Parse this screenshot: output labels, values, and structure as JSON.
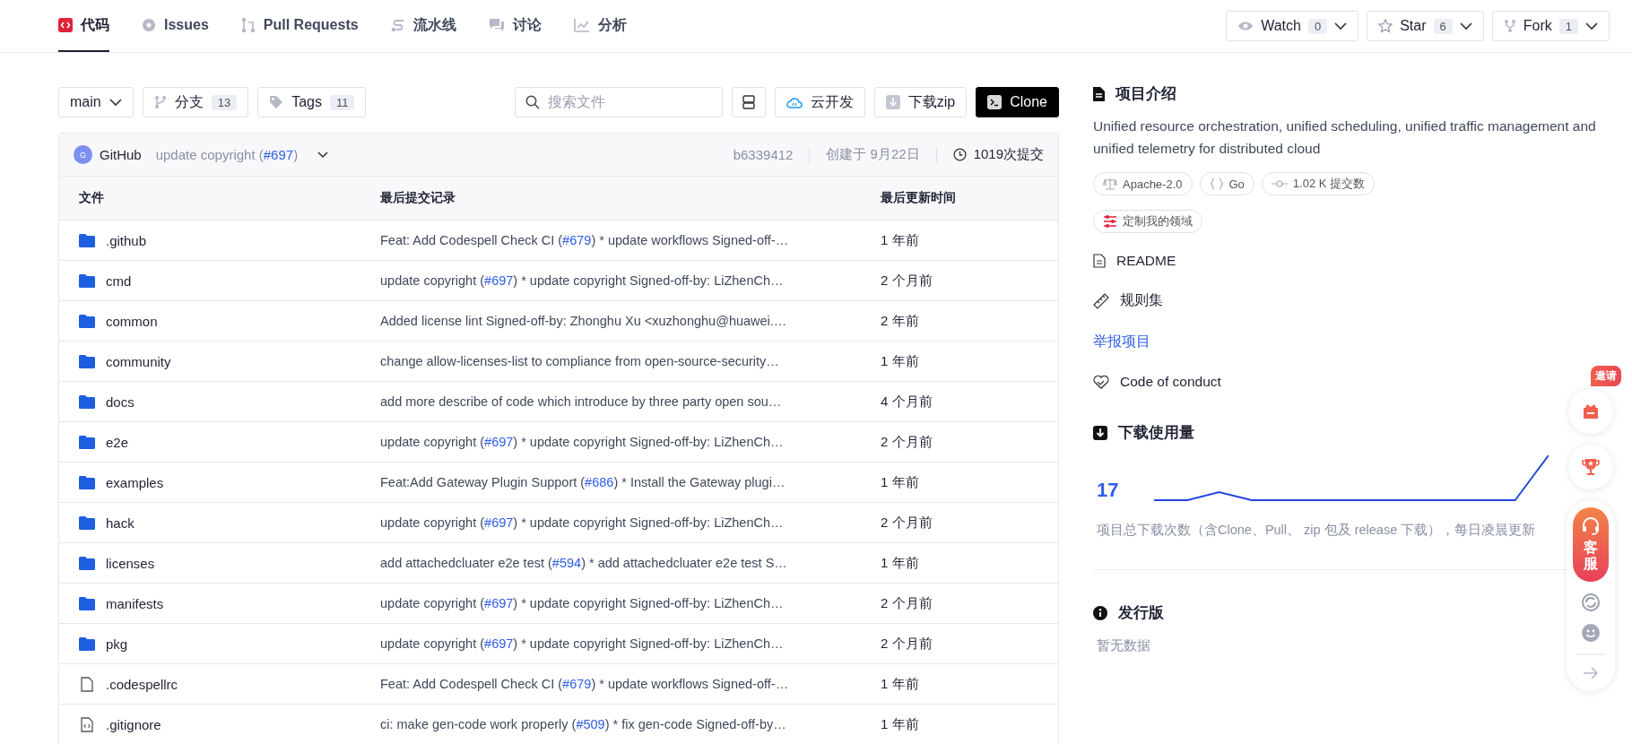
{
  "nav_tabs": [
    {
      "label": "代码",
      "kind": "code",
      "selected": true
    },
    {
      "label": "Issues",
      "kind": "issues",
      "selected": false
    },
    {
      "label": "Pull Requests",
      "kind": "pr",
      "selected": false
    },
    {
      "label": "流水线",
      "kind": "pipeline",
      "selected": false
    },
    {
      "label": "讨论",
      "kind": "discuss",
      "selected": false
    },
    {
      "label": "分析",
      "kind": "analytics",
      "selected": false
    }
  ],
  "repo_actions": [
    {
      "label": "Watch",
      "kind": "watch",
      "count": "0"
    },
    {
      "label": "Star",
      "kind": "star",
      "count": "6"
    },
    {
      "label": "Fork",
      "kind": "fork",
      "count": "1"
    }
  ],
  "toolbar": {
    "branch": "main",
    "branches": {
      "label": "分支",
      "count": "13"
    },
    "tags": {
      "label": "Tags",
      "count": "11"
    },
    "search": {
      "placeholder": "搜索文件"
    },
    "buttons": [
      {
        "label": "云开发",
        "kind": "cloud"
      },
      {
        "label": "下载zip",
        "kind": "download"
      },
      {
        "label": "Clone",
        "kind": "clone"
      }
    ]
  },
  "latest_commit": {
    "avatar": "G",
    "author": "GitHub",
    "message": [
      {
        "text": "update copyright (",
        "kind": "text"
      },
      {
        "text": "#697",
        "kind": "link"
      },
      {
        "text": ")",
        "kind": "text"
      }
    ],
    "hash": "b6339412",
    "created": "创建于 9月22日",
    "commits": "1019次提交"
  },
  "table": {
    "columns": [
      "文件",
      "最后提交记录",
      "最后更新时间"
    ],
    "rows": [
      {
        "name": ".github",
        "kind": "folder",
        "commit": [
          {
            "text": "Feat: Add Codespell Check CI (",
            "kind": "text"
          },
          {
            "text": "#679",
            "kind": "link"
          },
          {
            "text": ") * update workflows Signed-off-…",
            "kind": "text"
          }
        ],
        "time": "1 年前"
      },
      {
        "name": "cmd",
        "kind": "folder",
        "commit": [
          {
            "text": "update copyright (",
            "kind": "text"
          },
          {
            "text": "#697",
            "kind": "link"
          },
          {
            "text": ") * update copyright Signed-off-by: LiZhenCh…",
            "kind": "text"
          }
        ],
        "time": "2 个月前"
      },
      {
        "name": "common",
        "kind": "folder",
        "commit": [
          {
            "text": "Added license lint Signed-off-by: Zhonghu Xu <xuzhonghu@huawei.…",
            "kind": "text"
          }
        ],
        "time": "2 年前"
      },
      {
        "name": "community",
        "kind": "folder",
        "commit": [
          {
            "text": "change allow-licenses-list to compliance from open-source-security…",
            "kind": "text"
          }
        ],
        "time": "1 年前"
      },
      {
        "name": "docs",
        "kind": "folder",
        "commit": [
          {
            "text": "add more describe of code which introduce by three party open sou…",
            "kind": "text"
          }
        ],
        "time": "4 个月前"
      },
      {
        "name": "e2e",
        "kind": "folder",
        "commit": [
          {
            "text": "update copyright (",
            "kind": "text"
          },
          {
            "text": "#697",
            "kind": "link"
          },
          {
            "text": ") * update copyright Signed-off-by: LiZhenCh…",
            "kind": "text"
          }
        ],
        "time": "2 个月前"
      },
      {
        "name": "examples",
        "kind": "folder",
        "commit": [
          {
            "text": "Feat:Add Gateway Plugin Support (",
            "kind": "text"
          },
          {
            "text": "#686",
            "kind": "link"
          },
          {
            "text": ") * Install the Gateway plugi…",
            "kind": "text"
          }
        ],
        "time": "1 年前"
      },
      {
        "name": "hack",
        "kind": "folder",
        "commit": [
          {
            "text": "update copyright (",
            "kind": "text"
          },
          {
            "text": "#697",
            "kind": "link"
          },
          {
            "text": ") * update copyright Signed-off-by: LiZhenCh…",
            "kind": "text"
          }
        ],
        "time": "2 个月前"
      },
      {
        "name": "licenses",
        "kind": "folder",
        "commit": [
          {
            "text": "add attachedcluater e2e test (",
            "kind": "text"
          },
          {
            "text": "#594",
            "kind": "link"
          },
          {
            "text": ") * add attachedcluater e2e test S…",
            "kind": "text"
          }
        ],
        "time": "1 年前"
      },
      {
        "name": "manifests",
        "kind": "folder",
        "commit": [
          {
            "text": "update copyright (",
            "kind": "text"
          },
          {
            "text": "#697",
            "kind": "link"
          },
          {
            "text": ") * update copyright Signed-off-by: LiZhenCh…",
            "kind": "text"
          }
        ],
        "time": "2 个月前"
      },
      {
        "name": "pkg",
        "kind": "folder",
        "commit": [
          {
            "text": "update copyright (",
            "kind": "text"
          },
          {
            "text": "#697",
            "kind": "link"
          },
          {
            "text": ") * update copyright Signed-off-by: LiZhenCh…",
            "kind": "text"
          }
        ],
        "time": "2 个月前"
      },
      {
        "name": ".codespellrc",
        "kind": "file",
        "commit": [
          {
            "text": "Feat: Add Codespell Check CI (",
            "kind": "text"
          },
          {
            "text": "#679",
            "kind": "link"
          },
          {
            "text": ") * update workflows Signed-off-…",
            "kind": "text"
          }
        ],
        "time": "1 年前"
      },
      {
        "name": ".gitignore",
        "kind": "code-file",
        "commit": [
          {
            "text": "ci: make gen-code work properly (",
            "kind": "text"
          },
          {
            "text": "#509",
            "kind": "link"
          },
          {
            "text": ") * fix gen-code Signed-off-by…",
            "kind": "text"
          }
        ],
        "time": "1 年前"
      }
    ]
  },
  "sidebar": {
    "intro_title": "项目介绍",
    "description": "Unified resource orchestration, unified scheduling, unified traffic management and unified telemetry for distributed cloud",
    "tags": [
      {
        "label": "Apache-2.0",
        "kind": "license"
      },
      {
        "label": "Go",
        "kind": "language"
      },
      {
        "label": "1.02 K 提交数",
        "kind": "commits"
      }
    ],
    "customize": "定制我的领域",
    "links": [
      {
        "label": "README",
        "kind": "readme"
      },
      {
        "label": "规则集",
        "kind": "rules"
      },
      {
        "label": "举报项目",
        "kind": "report"
      },
      {
        "label": "Code of conduct",
        "kind": "conduct"
      }
    ],
    "downloads": {
      "title": "下载使用量",
      "total": "17",
      "note": "项目总下载次数（含Clone、Pull、 zip 包及 release 下载），每日凌晨更新"
    },
    "releases": {
      "title": "发行版",
      "empty": "暂无数据"
    }
  },
  "float_bar": {
    "badge": "邀请",
    "service": "客服"
  }
}
